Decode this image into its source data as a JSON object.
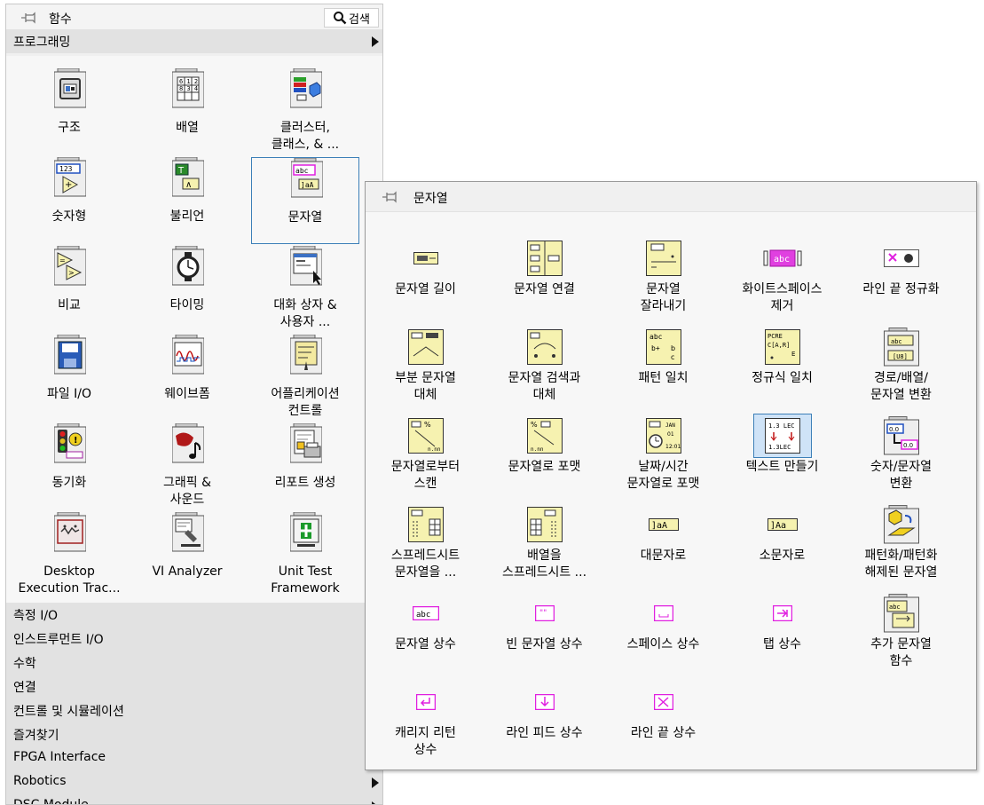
{
  "functions_palette": {
    "title": "함수",
    "search_label": "검색",
    "programming": {
      "label": "프로그래밍",
      "items": [
        {
          "label": "구조"
        },
        {
          "label": "배열"
        },
        {
          "label": "클러스터,\n클래스, & ..."
        },
        {
          "label": "숫자형"
        },
        {
          "label": "불리언"
        },
        {
          "label": "문자열"
        },
        {
          "label": "비교"
        },
        {
          "label": "타이밍"
        },
        {
          "label": "대화 상자 &\n사용자 ..."
        },
        {
          "label": "파일 I/O"
        },
        {
          "label": "웨이브폼"
        },
        {
          "label": "어플리케이션\n컨트롤"
        },
        {
          "label": "동기화"
        },
        {
          "label": "그래픽 &\n사운드"
        },
        {
          "label": "리포트 생성"
        },
        {
          "label": "Desktop\nExecution Trac..."
        },
        {
          "label": "VI Analyzer"
        },
        {
          "label": "Unit Test\nFramework"
        }
      ]
    },
    "categories": [
      {
        "label": "측정 I/O"
      },
      {
        "label": "인스트루먼트 I/O"
      },
      {
        "label": "수학"
      },
      {
        "label": "연결"
      },
      {
        "label": "컨트롤 및 시뮬레이션"
      },
      {
        "label": "즐겨찾기"
      },
      {
        "label": "FPGA Interface"
      },
      {
        "label": "Robotics"
      },
      {
        "label": "DSC Module"
      }
    ]
  },
  "string_palette": {
    "title": "문자열",
    "items": [
      {
        "label": "문자열 길이"
      },
      {
        "label": "문자열 연결"
      },
      {
        "label": "문자열\n잘라내기"
      },
      {
        "label": "화이트스페이스\n제거"
      },
      {
        "label": "라인 끝 정규화"
      },
      {
        "label": "부분 문자열\n대체"
      },
      {
        "label": "문자열 검색과\n대체"
      },
      {
        "label": "패턴 일치"
      },
      {
        "label": "정규식 일치"
      },
      {
        "label": "경로/배열/\n문자열 변환"
      },
      {
        "label": "문자열로부터\n스캔"
      },
      {
        "label": "문자열로 포맷"
      },
      {
        "label": "날짜/시간\n문자열로 포맷"
      },
      {
        "label": "텍스트 만들기"
      },
      {
        "label": "숫자/문자열\n변환"
      },
      {
        "label": "스프레드시트\n문자열을 ..."
      },
      {
        "label": "배열을\n스프레드시트 ..."
      },
      {
        "label": "대문자로"
      },
      {
        "label": "소문자로"
      },
      {
        "label": "패턴화/패턴화\n해제된 문자열"
      },
      {
        "label": "문자열 상수"
      },
      {
        "label": "빈 문자열 상수"
      },
      {
        "label": "스페이스 상수"
      },
      {
        "label": "탭 상수"
      },
      {
        "label": "추가 문자열\n함수"
      },
      {
        "label": "캐리지 리턴\n상수"
      },
      {
        "label": "라인 피드 상수"
      },
      {
        "label": "라인 끝 상수"
      }
    ]
  }
}
